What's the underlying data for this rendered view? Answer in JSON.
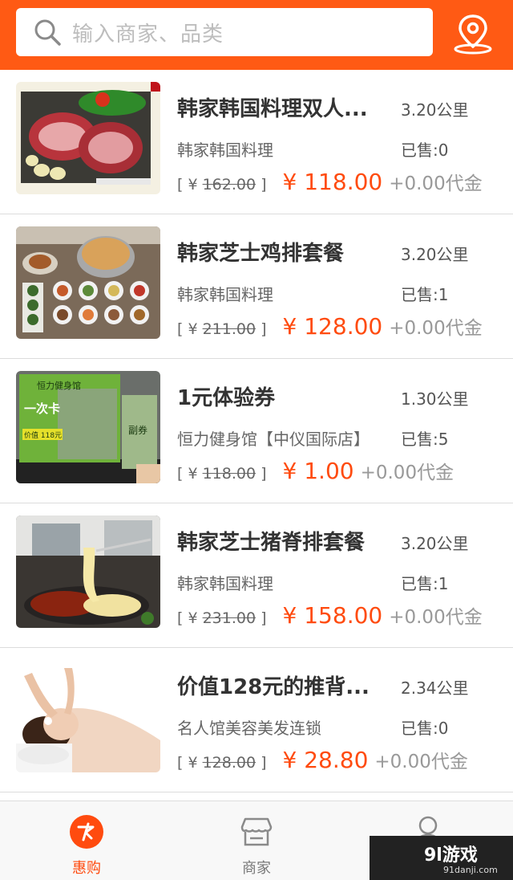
{
  "search": {
    "placeholder": "输入商家、品类"
  },
  "items": [
    {
      "title": "韩家韩国料理双人...",
      "distance": "3.20公里",
      "shop": "韩家韩国料理",
      "sold": "已售:0",
      "orig_prefix": "[ ¥ ",
      "orig_price": "162.00",
      "orig_suffix": " ]",
      "price": "¥ 118.00",
      "coupon": "+0.00代金"
    },
    {
      "title": "韩家芝士鸡排套餐",
      "distance": "3.20公里",
      "shop": "韩家韩国料理",
      "sold": "已售:1",
      "orig_prefix": "[ ¥ ",
      "orig_price": "211.00",
      "orig_suffix": " ]",
      "price": "¥ 128.00",
      "coupon": "+0.00代金"
    },
    {
      "title": "1元体验券",
      "distance": "1.30公里",
      "shop": "恒力健身馆【中仪国际店】",
      "sold": "已售:5",
      "orig_prefix": "[ ¥ ",
      "orig_price": "118.00",
      "orig_suffix": " ]",
      "price": "¥ 1.00",
      "coupon": "+0.00代金"
    },
    {
      "title": "韩家芝士猪脊排套餐",
      "distance": "3.20公里",
      "shop": "韩家韩国料理",
      "sold": "已售:1",
      "orig_prefix": "[ ¥ ",
      "orig_price": "231.00",
      "orig_suffix": " ]",
      "price": "¥ 158.00",
      "coupon": "+0.00代金"
    },
    {
      "title": "价值128元的推背...",
      "distance": "2.34公里",
      "shop": "名人馆美容美发连锁",
      "sold": "已售:0",
      "orig_prefix": "[ ¥ ",
      "orig_price": "128.00",
      "orig_suffix": " ]",
      "price": "¥ 28.80",
      "coupon": "+0.00代金"
    }
  ],
  "thumb_text": {
    "voucher_brand": "恒力健身馆",
    "voucher_card": "一次卡",
    "voucher_price": "价值 118元",
    "voucher_stub": "副券"
  },
  "tabs": [
    {
      "label": "惠购",
      "icon": "deal-icon",
      "active": true
    },
    {
      "label": "商家",
      "icon": "store-icon",
      "active": false
    },
    {
      "label": "",
      "icon": "user-icon",
      "active": false
    }
  ],
  "watermark": {
    "logo": "9l游戏",
    "url": "91danji.com"
  },
  "colors": {
    "accent": "#ff5a14",
    "price": "#ff4b0f",
    "muted": "#999999"
  }
}
